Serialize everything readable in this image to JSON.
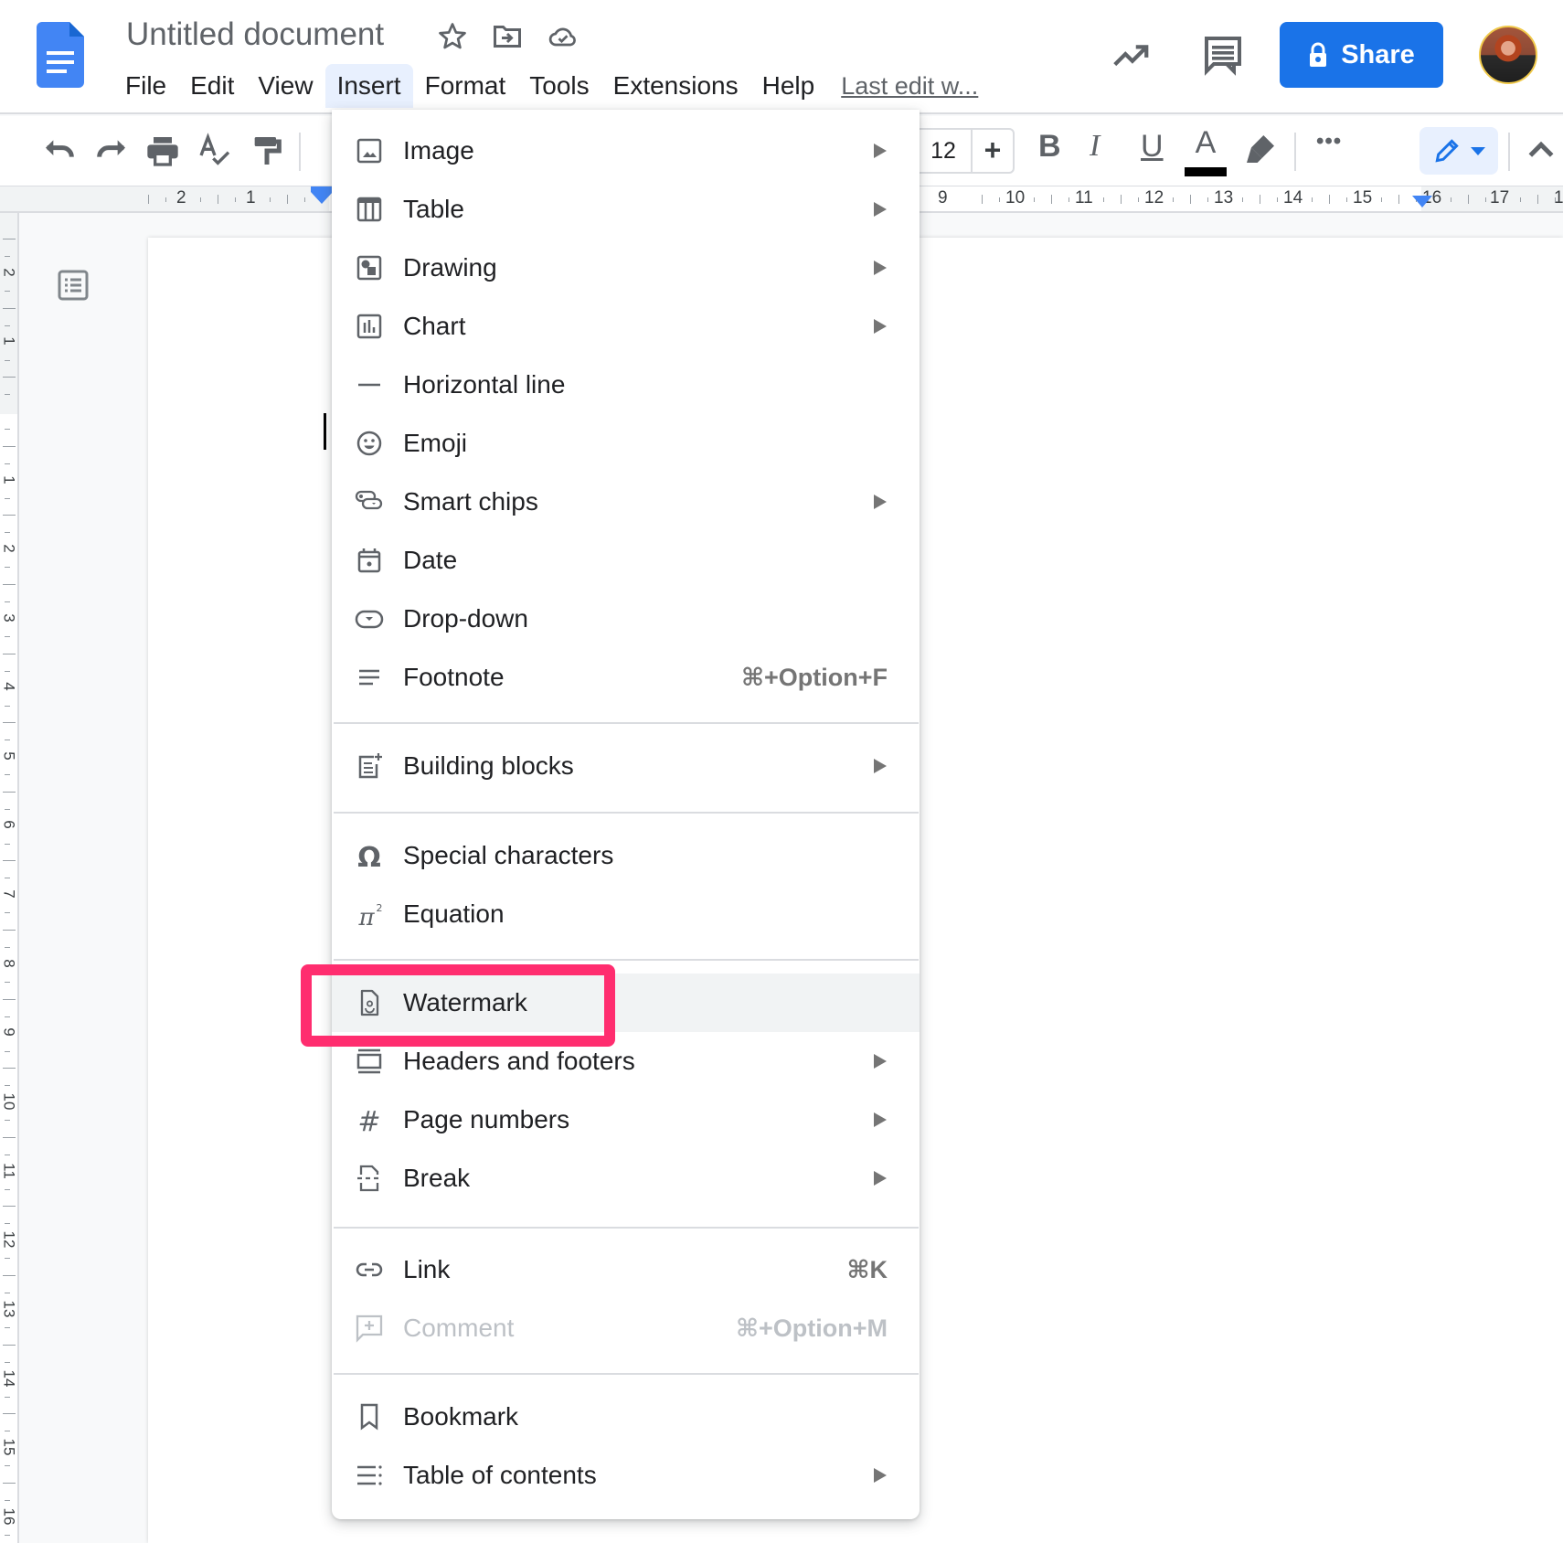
{
  "app": {
    "doc_title": "Untitled document",
    "menubar": [
      "File",
      "Edit",
      "View",
      "Insert",
      "Format",
      "Tools",
      "Extensions",
      "Help"
    ],
    "active_menu": "Insert",
    "last_edit": "Last edit w...",
    "share_label": "Share",
    "brand_color": "#1a73e8"
  },
  "toolbar": {
    "font_size": "12",
    "plus": "+",
    "bold": "B",
    "italic": "I",
    "underline": "U",
    "text_color_letter": "A",
    "text_color": "#000000",
    "more": "•••"
  },
  "ruler": {
    "horizontal": [
      "2",
      "1",
      "9",
      "10",
      "11",
      "12",
      "13",
      "14",
      "15",
      "16",
      "17",
      "1"
    ],
    "vertical": [
      "2",
      "1",
      "1",
      "2",
      "3",
      "4",
      "5",
      "6",
      "7",
      "8",
      "9",
      "10",
      "11",
      "12",
      "13",
      "14",
      "15",
      "16"
    ]
  },
  "insert_menu": {
    "items": [
      {
        "label": "Image",
        "icon": "image-icon",
        "submenu": true
      },
      {
        "label": "Table",
        "icon": "table-icon",
        "submenu": true
      },
      {
        "label": "Drawing",
        "icon": "drawing-icon",
        "submenu": true
      },
      {
        "label": "Chart",
        "icon": "chart-icon",
        "submenu": true
      },
      {
        "label": "Horizontal line",
        "icon": "horizontal-line-icon",
        "submenu": false
      },
      {
        "label": "Emoji",
        "icon": "emoji-icon",
        "submenu": false
      },
      {
        "label": "Smart chips",
        "icon": "smart-chips-icon",
        "submenu": true
      },
      {
        "label": "Date",
        "icon": "calendar-icon",
        "submenu": false
      },
      {
        "label": "Drop-down",
        "icon": "dropdown-icon",
        "submenu": false
      },
      {
        "label": "Footnote",
        "icon": "footnote-icon",
        "shortcut": "⌘+Option+F"
      },
      {
        "label": "Building blocks",
        "icon": "building-blocks-icon",
        "submenu": true
      },
      {
        "label": "Special characters",
        "icon": "omega-icon",
        "submenu": false
      },
      {
        "label": "Equation",
        "icon": "pi-icon",
        "submenu": false
      },
      {
        "label": "Watermark",
        "icon": "watermark-icon",
        "submenu": false,
        "highlighted": true
      },
      {
        "label": "Headers and footers",
        "icon": "headers-footers-icon",
        "submenu": true
      },
      {
        "label": "Page numbers",
        "icon": "hash-icon",
        "submenu": true
      },
      {
        "label": "Break",
        "icon": "break-icon",
        "submenu": true
      },
      {
        "label": "Link",
        "icon": "link-icon",
        "shortcut": "⌘K"
      },
      {
        "label": "Comment",
        "icon": "add-comment-icon",
        "shortcut": "⌘+Option+M",
        "disabled": true
      },
      {
        "label": "Bookmark",
        "icon": "bookmark-icon",
        "submenu": false
      },
      {
        "label": "Table of contents",
        "icon": "table-of-contents-icon",
        "submenu": true
      }
    ],
    "highlight_color": "#ff2d6f"
  }
}
